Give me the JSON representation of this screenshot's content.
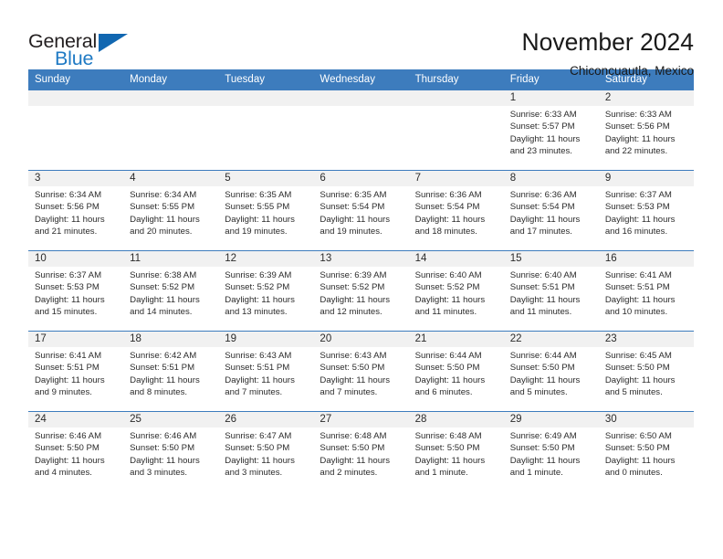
{
  "brand": {
    "name_part1": "General",
    "name_part2": "Blue"
  },
  "header": {
    "title": "November 2024",
    "subtitle": "Chiconcuautla, Mexico"
  },
  "colors": {
    "header_blue": "#3d7cbd",
    "brand_blue": "#1f7ac4",
    "daynum_band": "#f1f1f1"
  },
  "weekdays": [
    "Sunday",
    "Monday",
    "Tuesday",
    "Wednesday",
    "Thursday",
    "Friday",
    "Saturday"
  ],
  "weeks": [
    [
      {
        "day": "",
        "lines": [
          "",
          "",
          "",
          ""
        ]
      },
      {
        "day": "",
        "lines": [
          "",
          "",
          "",
          ""
        ]
      },
      {
        "day": "",
        "lines": [
          "",
          "",
          "",
          ""
        ]
      },
      {
        "day": "",
        "lines": [
          "",
          "",
          "",
          ""
        ]
      },
      {
        "day": "",
        "lines": [
          "",
          "",
          "",
          ""
        ]
      },
      {
        "day": "1",
        "lines": [
          "Sunrise: 6:33 AM",
          "Sunset: 5:57 PM",
          "Daylight: 11 hours",
          "and 23 minutes."
        ]
      },
      {
        "day": "2",
        "lines": [
          "Sunrise: 6:33 AM",
          "Sunset: 5:56 PM",
          "Daylight: 11 hours",
          "and 22 minutes."
        ]
      }
    ],
    [
      {
        "day": "3",
        "lines": [
          "Sunrise: 6:34 AM",
          "Sunset: 5:56 PM",
          "Daylight: 11 hours",
          "and 21 minutes."
        ]
      },
      {
        "day": "4",
        "lines": [
          "Sunrise: 6:34 AM",
          "Sunset: 5:55 PM",
          "Daylight: 11 hours",
          "and 20 minutes."
        ]
      },
      {
        "day": "5",
        "lines": [
          "Sunrise: 6:35 AM",
          "Sunset: 5:55 PM",
          "Daylight: 11 hours",
          "and 19 minutes."
        ]
      },
      {
        "day": "6",
        "lines": [
          "Sunrise: 6:35 AM",
          "Sunset: 5:54 PM",
          "Daylight: 11 hours",
          "and 19 minutes."
        ]
      },
      {
        "day": "7",
        "lines": [
          "Sunrise: 6:36 AM",
          "Sunset: 5:54 PM",
          "Daylight: 11 hours",
          "and 18 minutes."
        ]
      },
      {
        "day": "8",
        "lines": [
          "Sunrise: 6:36 AM",
          "Sunset: 5:54 PM",
          "Daylight: 11 hours",
          "and 17 minutes."
        ]
      },
      {
        "day": "9",
        "lines": [
          "Sunrise: 6:37 AM",
          "Sunset: 5:53 PM",
          "Daylight: 11 hours",
          "and 16 minutes."
        ]
      }
    ],
    [
      {
        "day": "10",
        "lines": [
          "Sunrise: 6:37 AM",
          "Sunset: 5:53 PM",
          "Daylight: 11 hours",
          "and 15 minutes."
        ]
      },
      {
        "day": "11",
        "lines": [
          "Sunrise: 6:38 AM",
          "Sunset: 5:52 PM",
          "Daylight: 11 hours",
          "and 14 minutes."
        ]
      },
      {
        "day": "12",
        "lines": [
          "Sunrise: 6:39 AM",
          "Sunset: 5:52 PM",
          "Daylight: 11 hours",
          "and 13 minutes."
        ]
      },
      {
        "day": "13",
        "lines": [
          "Sunrise: 6:39 AM",
          "Sunset: 5:52 PM",
          "Daylight: 11 hours",
          "and 12 minutes."
        ]
      },
      {
        "day": "14",
        "lines": [
          "Sunrise: 6:40 AM",
          "Sunset: 5:52 PM",
          "Daylight: 11 hours",
          "and 11 minutes."
        ]
      },
      {
        "day": "15",
        "lines": [
          "Sunrise: 6:40 AM",
          "Sunset: 5:51 PM",
          "Daylight: 11 hours",
          "and 11 minutes."
        ]
      },
      {
        "day": "16",
        "lines": [
          "Sunrise: 6:41 AM",
          "Sunset: 5:51 PM",
          "Daylight: 11 hours",
          "and 10 minutes."
        ]
      }
    ],
    [
      {
        "day": "17",
        "lines": [
          "Sunrise: 6:41 AM",
          "Sunset: 5:51 PM",
          "Daylight: 11 hours",
          "and 9 minutes."
        ]
      },
      {
        "day": "18",
        "lines": [
          "Sunrise: 6:42 AM",
          "Sunset: 5:51 PM",
          "Daylight: 11 hours",
          "and 8 minutes."
        ]
      },
      {
        "day": "19",
        "lines": [
          "Sunrise: 6:43 AM",
          "Sunset: 5:51 PM",
          "Daylight: 11 hours",
          "and 7 minutes."
        ]
      },
      {
        "day": "20",
        "lines": [
          "Sunrise: 6:43 AM",
          "Sunset: 5:50 PM",
          "Daylight: 11 hours",
          "and 7 minutes."
        ]
      },
      {
        "day": "21",
        "lines": [
          "Sunrise: 6:44 AM",
          "Sunset: 5:50 PM",
          "Daylight: 11 hours",
          "and 6 minutes."
        ]
      },
      {
        "day": "22",
        "lines": [
          "Sunrise: 6:44 AM",
          "Sunset: 5:50 PM",
          "Daylight: 11 hours",
          "and 5 minutes."
        ]
      },
      {
        "day": "23",
        "lines": [
          "Sunrise: 6:45 AM",
          "Sunset: 5:50 PM",
          "Daylight: 11 hours",
          "and 5 minutes."
        ]
      }
    ],
    [
      {
        "day": "24",
        "lines": [
          "Sunrise: 6:46 AM",
          "Sunset: 5:50 PM",
          "Daylight: 11 hours",
          "and 4 minutes."
        ]
      },
      {
        "day": "25",
        "lines": [
          "Sunrise: 6:46 AM",
          "Sunset: 5:50 PM",
          "Daylight: 11 hours",
          "and 3 minutes."
        ]
      },
      {
        "day": "26",
        "lines": [
          "Sunrise: 6:47 AM",
          "Sunset: 5:50 PM",
          "Daylight: 11 hours",
          "and 3 minutes."
        ]
      },
      {
        "day": "27",
        "lines": [
          "Sunrise: 6:48 AM",
          "Sunset: 5:50 PM",
          "Daylight: 11 hours",
          "and 2 minutes."
        ]
      },
      {
        "day": "28",
        "lines": [
          "Sunrise: 6:48 AM",
          "Sunset: 5:50 PM",
          "Daylight: 11 hours",
          "and 1 minute."
        ]
      },
      {
        "day": "29",
        "lines": [
          "Sunrise: 6:49 AM",
          "Sunset: 5:50 PM",
          "Daylight: 11 hours",
          "and 1 minute."
        ]
      },
      {
        "day": "30",
        "lines": [
          "Sunrise: 6:50 AM",
          "Sunset: 5:50 PM",
          "Daylight: 11 hours",
          "and 0 minutes."
        ]
      }
    ]
  ]
}
